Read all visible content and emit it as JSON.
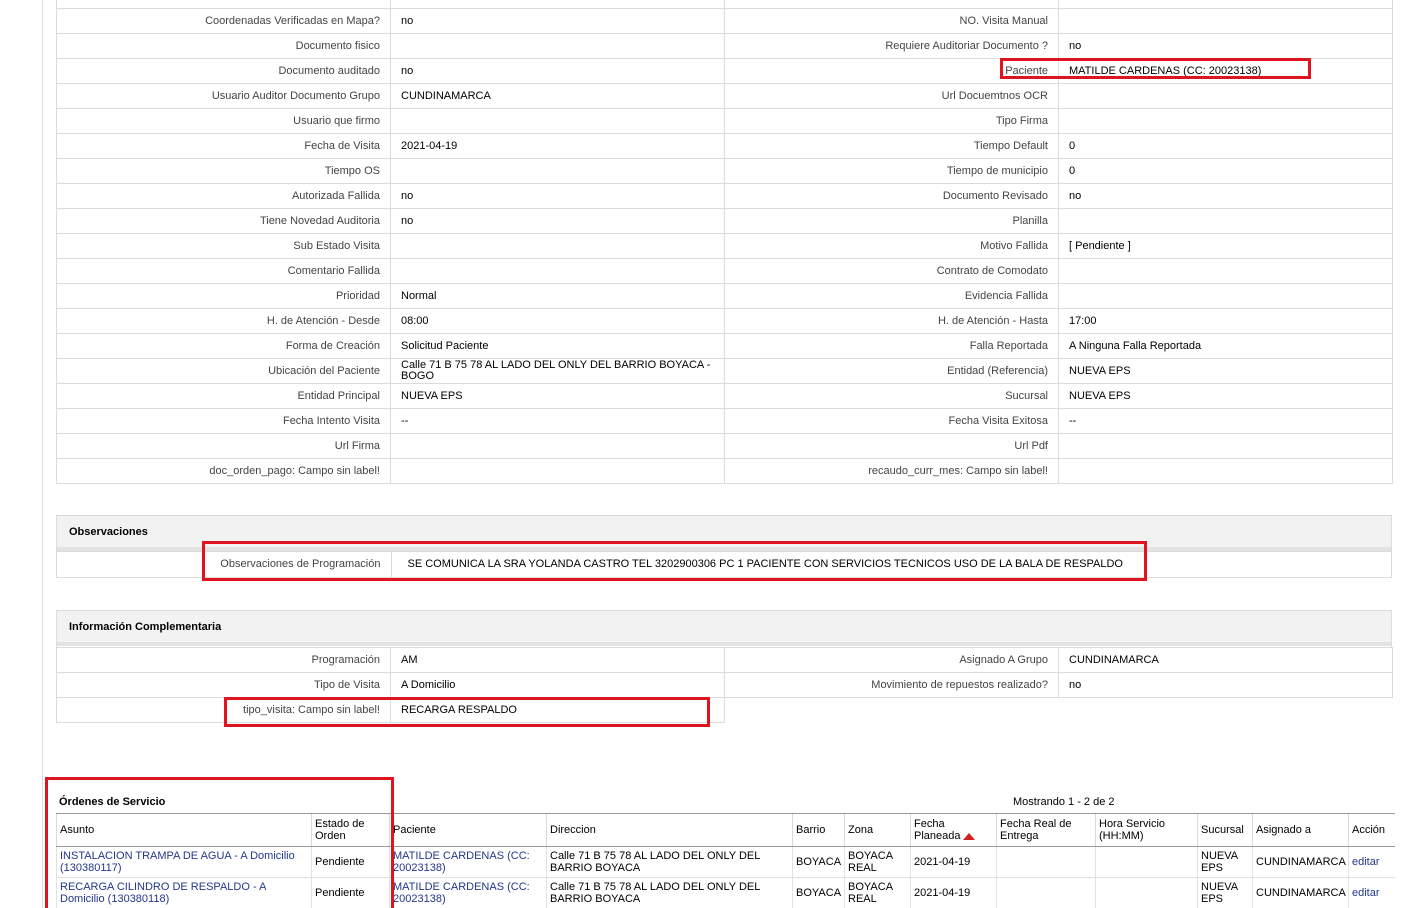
{
  "detail_rows": [
    {
      "l1": "Coordenadas Verificadas en Mapa?",
      "v1": "no",
      "l2": "NO. Visita Manual",
      "v2": ""
    },
    {
      "l1": "Documento fisico",
      "v1": "",
      "l2": "Requiere Auditoriar Documento ?",
      "v2": "no"
    },
    {
      "l1": "Documento auditado",
      "v1": "no",
      "l2": "Paciente",
      "v2": "MATILDE CARDENAS (CC: 20023138)"
    },
    {
      "l1": "Usuario Auditor Documento Grupo",
      "v1": "CUNDINAMARCA",
      "l2": "Url Docuemtnos OCR",
      "v2": ""
    },
    {
      "l1": "Usuario que firmo",
      "v1": "",
      "l2": "Tipo Firma",
      "v2": ""
    },
    {
      "l1": "Fecha de Visita",
      "v1": "2021-04-19",
      "l2": "Tiempo Default",
      "v2": "0"
    },
    {
      "l1": "Tiempo OS",
      "v1": "",
      "l2": "Tiempo de municipio",
      "v2": "0"
    },
    {
      "l1": "Autorizada Fallida",
      "v1": "no",
      "l2": "Documento Revisado",
      "v2": "no"
    },
    {
      "l1": "Tiene Novedad Auditoria",
      "v1": "no",
      "l2": "Planilla",
      "v2": ""
    },
    {
      "l1": "Sub Estado Visita",
      "v1": "",
      "l2": "Motivo Fallida",
      "v2": "[ Pendiente ]"
    },
    {
      "l1": "Comentario Fallida",
      "v1": "",
      "l2": "Contrato de Comodato",
      "v2": ""
    },
    {
      "l1": "Prioridad",
      "v1": "Normal",
      "l2": "Evidencia Fallida",
      "v2": ""
    },
    {
      "l1": "H. de Atención - Desde",
      "v1": "08:00",
      "l2": "H. de Atención - Hasta",
      "v2": "17:00"
    },
    {
      "l1": "Forma de Creación",
      "v1": "Solicitud Paciente",
      "l2": "Falla Reportada",
      "v2": "A Ninguna Falla Reportada"
    },
    {
      "l1": "Ubicación del Paciente",
      "v1": "Calle 71 B 75 78 AL LADO DEL ONLY DEL BARRIO BOYACA - BOGO",
      "l2": "Entidad (Referencia)",
      "v2": "NUEVA EPS"
    },
    {
      "l1": "Entidad Principal",
      "v1": "NUEVA EPS",
      "l2": "Sucursal",
      "v2": "NUEVA EPS"
    },
    {
      "l1": "Fecha Intento Visita",
      "v1": "--",
      "l2": "Fecha Visita Exitosa",
      "v2": "--"
    },
    {
      "l1": "Url Firma",
      "v1": "",
      "l2": "Url Pdf",
      "v2": ""
    },
    {
      "l1": "doc_orden_pago: Campo sin label!",
      "v1": "",
      "l2": "recaudo_curr_mes: Campo sin label!",
      "v2": ""
    }
  ],
  "observaciones": {
    "title": "Observaciones",
    "label": "Observaciones de Programación",
    "value": "SE COMUNICA LA SRA YOLANDA CASTRO TEL 3202900306 PC 1 PACIENTE CON SERVICIOS TECNICOS USO DE LA BALA DE RESPALDO"
  },
  "info": {
    "title": "Información Complementaria",
    "rows": [
      {
        "l1": "Programación",
        "v1": "AM",
        "l2": "Asignado A Grupo",
        "v2": "CUNDINAMARCA"
      },
      {
        "l1": "Tipo de Visita",
        "v1": "A Domicilio",
        "l2": "Movimiento de repuestos realizado?",
        "v2": "no"
      },
      {
        "l1": "tipo_visita: Campo sin label!",
        "v1": "RECARGA RESPALDO"
      }
    ]
  },
  "orders": {
    "title": "Órdenes de Servicio",
    "count": "Mostrando 1 - 2 de 2",
    "headers": [
      "Asunto",
      "Estado de Orden",
      "Paciente",
      "Direccion",
      "Barrio",
      "Zona",
      "Fecha Planeada",
      "Fecha Real de Entrega",
      "Hora Servicio (HH:MM)",
      "Sucursal",
      "Asignado a",
      "Acción"
    ],
    "rows": [
      {
        "asunto": "INSTALACION TRAMPA DE AGUA - A Domicilio (130380117)",
        "estado": "Pendiente",
        "paciente": "MATILDE CARDENAS (CC: 20023138)",
        "direccion": "Calle 71 B 75 78 AL LADO DEL ONLY DEL BARRIO BOYACA",
        "barrio": "BOYACA",
        "zona": "BOYACA REAL",
        "fecha": "2021-04-19",
        "fecha_real": "",
        "hora": "",
        "sucursal": "NUEVA EPS",
        "asignado": "CUNDINAMARCA",
        "accion": "editar"
      },
      {
        "asunto": "RECARGA CILINDRO DE RESPALDO - A Domicilio (130380118)",
        "estado": "Pendiente",
        "paciente": "MATILDE CARDENAS (CC: 20023138)",
        "direccion": "Calle 71 B 75 78 AL LADO DEL ONLY DEL BARRIO BOYACA",
        "barrio": "BOYACA",
        "zona": "BOYACA REAL",
        "fecha": "2021-04-19",
        "fecha_real": "",
        "hora": "",
        "sucursal": "NUEVA EPS",
        "asignado": "CUNDINAMARCA",
        "accion": "editar"
      }
    ]
  },
  "colors": {
    "highlight": "#e0141e",
    "link": "#22378a",
    "border": "#dcdcdc"
  }
}
